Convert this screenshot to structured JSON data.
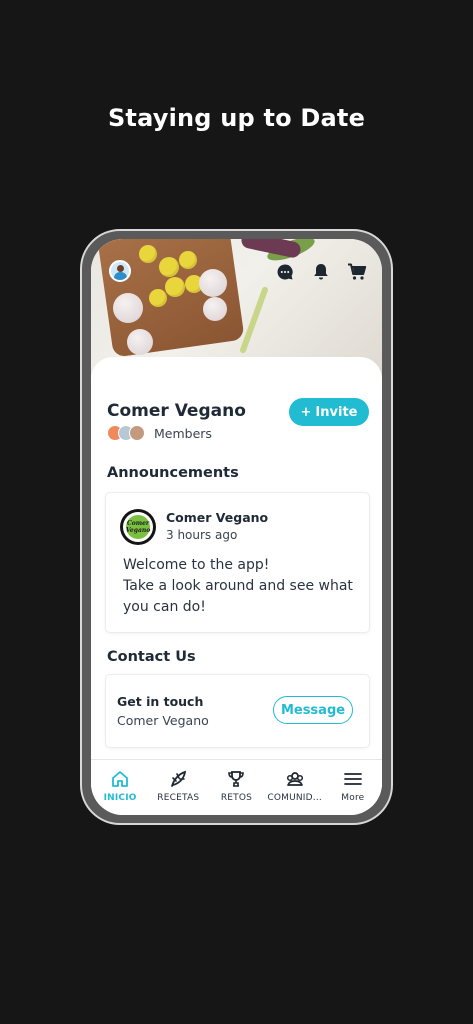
{
  "headline": "Staying up to Date",
  "colors": {
    "accent": "#22bcd2",
    "background": "#161616",
    "text": "#202a36"
  },
  "header": {
    "icons": [
      "user-avatar-icon",
      "chat-icon",
      "bell-icon",
      "cart-icon"
    ]
  },
  "group": {
    "name": "Comer Vegano",
    "members_label": "Members",
    "invite_label": "Invite"
  },
  "announcements": {
    "title": "Announcements",
    "post": {
      "author": "Comer Vegano",
      "time": "3 hours ago",
      "logo_text": "Comer Vegano",
      "lines": [
        "Welcome to the app!",
        "Take a look around and see what you can do!"
      ]
    }
  },
  "contact": {
    "title": "Contact Us",
    "card_title": "Get in touch",
    "card_sub": "Comer Vegano",
    "message_label": "Message"
  },
  "nav": {
    "items": [
      {
        "label": "INICIO",
        "icon": "home-icon",
        "active": true
      },
      {
        "label": "RECETAS",
        "icon": "leaf-icon",
        "active": false
      },
      {
        "label": "RETOS",
        "icon": "trophy-icon",
        "active": false
      },
      {
        "label": "COMUNID...",
        "icon": "community-icon",
        "active": false
      },
      {
        "label": "More",
        "icon": "menu-icon",
        "active": false
      }
    ]
  }
}
